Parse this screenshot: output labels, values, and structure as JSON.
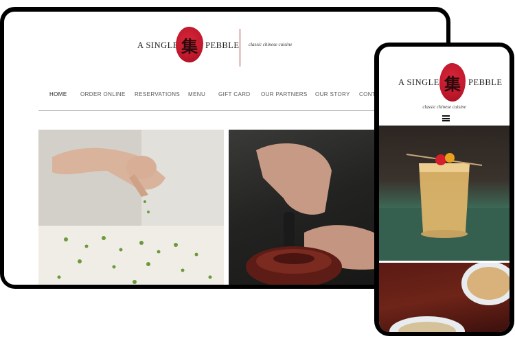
{
  "brand": {
    "name_left": "A SINGLE",
    "name_right": "PEBBLE",
    "seal_glyph": "集",
    "tagline": "classic chinese cuisine",
    "seal_color": "#c0182b"
  },
  "nav": {
    "items": [
      "HOME",
      "ORDER ONLINE",
      "RESERVATIONS",
      "MENU",
      "GIFT CARD",
      "OUR PARTNERS",
      "OUR STORY",
      "CONT"
    ]
  },
  "mobile": {
    "menu_icon": "hamburger-menu-icon"
  }
}
